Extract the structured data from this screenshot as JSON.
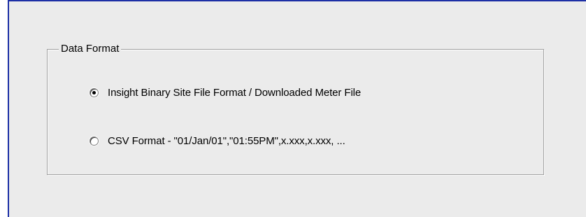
{
  "group": {
    "title": "Data Format"
  },
  "options": [
    {
      "label": "Insight Binary Site File Format / Downloaded Meter File",
      "selected": true
    },
    {
      "label": "CSV Format - \"01/Jan/01\",\"01:55PM\",x.xxx,x.xxx, ...",
      "selected": false
    }
  ]
}
